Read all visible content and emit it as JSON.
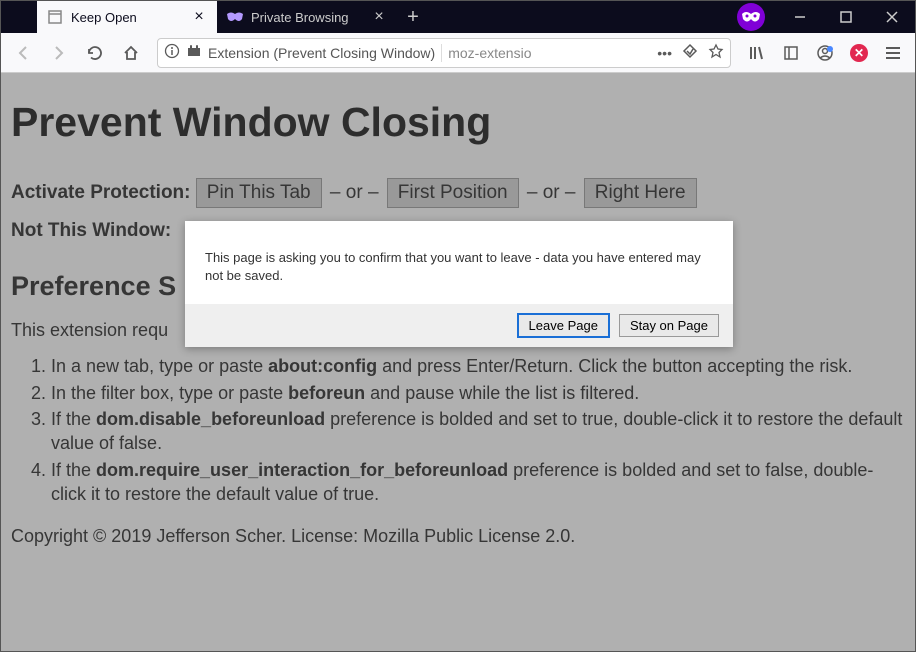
{
  "tabs": [
    {
      "label": "Keep Open",
      "active": true
    },
    {
      "label": "Private Browsing",
      "active": false
    }
  ],
  "url": {
    "identity": "Extension (Prevent Closing Window)",
    "path": "moz-extensio"
  },
  "page": {
    "h1": "Prevent Window Closing",
    "activate_label": "Activate Protection:",
    "pin_btn": "Pin This Tab",
    "sep": "– or –",
    "first_btn": "First Position",
    "here_btn": "Right Here",
    "not_window_label": "Not This Window:",
    "h2": "Preference S",
    "intro": "This extension requ",
    "steps": [
      {
        "pre": "In a new tab, type or paste ",
        "bold": "about:config",
        "post": " and press Enter/Return. Click the button accepting the risk."
      },
      {
        "pre": "In the filter box, type or paste ",
        "bold": "beforeun",
        "post": " and pause while the list is filtered."
      },
      {
        "pre": "If the ",
        "bold": "dom.disable_beforeunload",
        "post": " preference is bolded and set to true, double-click it to restore the default value of false."
      },
      {
        "pre": "If the ",
        "bold": "dom.require_user_interaction_for_beforeunload",
        "post": " preference is bolded and set to false, double-click it to restore the default value of true."
      }
    ],
    "footer": "Copyright © 2019 Jefferson Scher. License: Mozilla Public License 2.0."
  },
  "dialog": {
    "message": "This page is asking you to confirm that you want to leave - data you have entered may not be saved.",
    "leave": "Leave Page",
    "stay": "Stay on Page"
  }
}
